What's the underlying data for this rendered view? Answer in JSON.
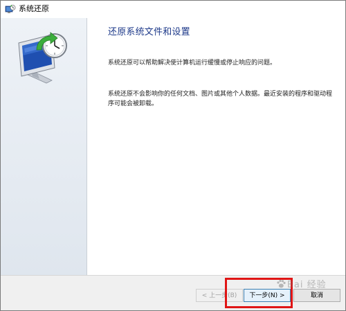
{
  "window": {
    "title": "系统还原"
  },
  "content": {
    "heading": "还原系统文件和设置",
    "paragraph1": "系统还原可以帮助解决使计算机运行缓慢或停止响应的问题。",
    "paragraph2": "系统还原不会影响你的任何文档、图片或其他个人数据。最近安装的程序和驱动程序可能会被卸载。"
  },
  "footer": {
    "back_label": "< 上一步(B)",
    "next_label": "下一步(N) >",
    "cancel_label": "取消"
  },
  "watermark": {
    "text": "Bai 经验"
  },
  "colors": {
    "heading": "#1e3a8a",
    "highlight": "#e01515",
    "accent_border": "#3c7fb1"
  },
  "icons": {
    "title": "system-restore-icon",
    "hero": "restore-clock-monitor-icon"
  }
}
